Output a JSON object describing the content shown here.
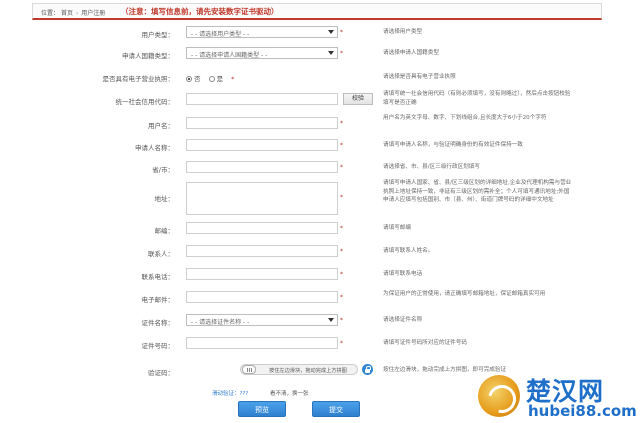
{
  "breadcrumb": {
    "location_label": "位置：",
    "home": "首页",
    "current": "用户注册"
  },
  "notice": "（注意：填写信息前，请先安装数字证书驱动）",
  "form": {
    "user_type": {
      "label": "用户类型：",
      "value": "- - 请选择用户类型 - -",
      "required": "*",
      "hint": "请选择用户类型"
    },
    "applicant_nationality": {
      "label": "申请人国籍类型：",
      "value": "- - 请选择申请人国籍类型 - -",
      "required": "*",
      "hint": "请选择申请人国籍类型"
    },
    "e_license": {
      "label": "是否具有电子营业执照：",
      "options": [
        "否",
        "是"
      ],
      "selected": "否",
      "required": "*",
      "hint": "请选择是否具有电子营业执照"
    },
    "credit_code": {
      "label": "统一社会信用代码：",
      "value": "",
      "button": "校验",
      "hint": "请填写统一社会信用代码（有则必须填写，没有则略过），然后点击按钮校验填写是否正确"
    },
    "username": {
      "label": "用户名：",
      "value": "",
      "required": "*",
      "hint": "用户名为英文字母、数字、下划线组合,且长度大于6小于20个字符"
    },
    "applicant_name": {
      "label": "申请人名称：",
      "value": "",
      "required": "*",
      "hint": "请填写申请人名称，与验证明确身份的有效证件保持一致"
    },
    "province_city": {
      "label": "省/市：",
      "value": "",
      "required": "*",
      "hint": "请选择省、市、县/区三级行政区划填写"
    },
    "address": {
      "label": "地址：",
      "value": "",
      "required": "*",
      "hint": "请填写申请人国家、省、县/区三级区划的详细地址,企业及代理机构需与营业执照上地址保持一致，非延有三级区划的需补全；个人可填写通讯地址;外国申请人应填写包括国别、市（县、州）、街道门牌号码的详细中文地址"
    },
    "postcode": {
      "label": "邮编：",
      "value": "",
      "required": "*",
      "hint": "请填写邮编"
    },
    "contact": {
      "label": "联系人：",
      "value": "",
      "required": "*",
      "hint": "请填写联系人姓名。"
    },
    "phone": {
      "label": "联系电话：",
      "value": "",
      "required": "*",
      "hint": "请填写联系电话"
    },
    "email": {
      "label": "电子邮件：",
      "value": "",
      "required": "*",
      "hint": "为保证用户的正常使用，请正确填写邮箱地址，保证邮箱真实可用"
    },
    "cert_name": {
      "label": "证件名称：",
      "value": "- - 请选择证件名称 - -",
      "required": "*",
      "hint": "请选择证件名称"
    },
    "cert_number": {
      "label": "证件号码：",
      "value": "",
      "required": "*",
      "hint": "请填写证件号码所对应的证件号码"
    },
    "captcha": {
      "label": "验证码：",
      "slider_text": "按住左边滑块，拖动完成上方拼图",
      "required": "*",
      "hint": "按住左边滑块，拖动完成上方拼图，即可完成验证"
    }
  },
  "status": {
    "left": "滑动验证：???",
    "right": "看不清，换一张"
  },
  "buttons": {
    "preview": "预览",
    "submit": "提交"
  },
  "watermark": {
    "text": "楚汉网",
    "url": "hubei88.com"
  },
  "colors": {
    "accent_red": "#c0392b",
    "button_blue": "#2f80cf",
    "watermark_blue": "#1e6fc9"
  }
}
